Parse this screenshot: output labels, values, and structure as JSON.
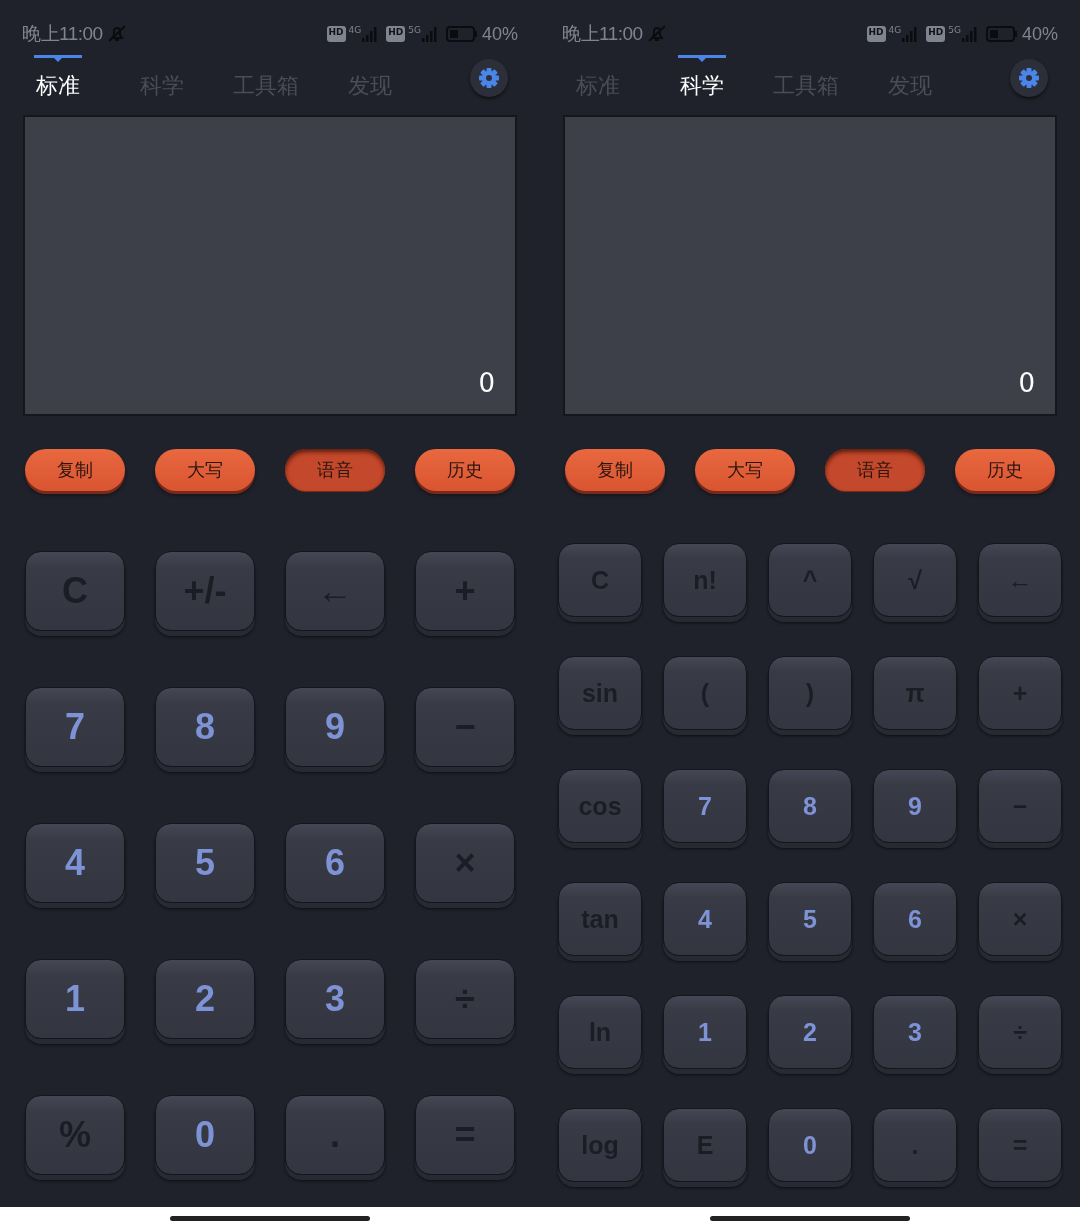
{
  "screens": [
    {
      "status_bar": {
        "time": "晚上11:00",
        "sims": [
          {
            "hd": "HD",
            "network": "4G"
          },
          {
            "hd": "HD",
            "network": "5G"
          }
        ],
        "battery": "40%"
      },
      "tabs": [
        {
          "label": "标准",
          "selected": true
        },
        {
          "label": "科学",
          "selected": false
        },
        {
          "label": "工具箱",
          "selected": false
        },
        {
          "label": "发现",
          "selected": false
        }
      ],
      "display": {
        "value": "0"
      },
      "tool_buttons": [
        {
          "label": "复制",
          "pressed": false
        },
        {
          "label": "大写",
          "pressed": false
        },
        {
          "label": "语音",
          "pressed": true
        },
        {
          "label": "历史",
          "pressed": false
        }
      ],
      "keys": [
        [
          {
            "label": "C",
            "kind": "func"
          },
          {
            "label": "+/-",
            "kind": "func"
          },
          {
            "label": "←",
            "kind": "func"
          },
          {
            "label": "+",
            "kind": "func"
          }
        ],
        [
          {
            "label": "7",
            "kind": "digit"
          },
          {
            "label": "8",
            "kind": "digit"
          },
          {
            "label": "9",
            "kind": "digit"
          },
          {
            "label": "−",
            "kind": "func"
          }
        ],
        [
          {
            "label": "4",
            "kind": "digit"
          },
          {
            "label": "5",
            "kind": "digit"
          },
          {
            "label": "6",
            "kind": "digit"
          },
          {
            "label": "×",
            "kind": "func"
          }
        ],
        [
          {
            "label": "1",
            "kind": "digit"
          },
          {
            "label": "2",
            "kind": "digit"
          },
          {
            "label": "3",
            "kind": "digit"
          },
          {
            "label": "÷",
            "kind": "func"
          }
        ],
        [
          {
            "label": "%",
            "kind": "func"
          },
          {
            "label": "0",
            "kind": "digit"
          },
          {
            "label": ".",
            "kind": "func"
          },
          {
            "label": "=",
            "kind": "func"
          }
        ]
      ]
    },
    {
      "status_bar": {
        "time": "晚上11:00",
        "sims": [
          {
            "hd": "HD",
            "network": "4G"
          },
          {
            "hd": "HD",
            "network": "5G"
          }
        ],
        "battery": "40%"
      },
      "tabs": [
        {
          "label": "标准",
          "selected": false
        },
        {
          "label": "科学",
          "selected": true
        },
        {
          "label": "工具箱",
          "selected": false
        },
        {
          "label": "发现",
          "selected": false
        }
      ],
      "display": {
        "value": "0"
      },
      "tool_buttons": [
        {
          "label": "复制",
          "pressed": false
        },
        {
          "label": "大写",
          "pressed": false
        },
        {
          "label": "语音",
          "pressed": true
        },
        {
          "label": "历史",
          "pressed": false
        }
      ],
      "keys": [
        [
          {
            "label": "C",
            "kind": "func"
          },
          {
            "label": "n!",
            "kind": "func"
          },
          {
            "label": "^",
            "kind": "func"
          },
          {
            "label": "√",
            "kind": "func"
          },
          {
            "label": "←",
            "kind": "func"
          }
        ],
        [
          {
            "label": "sin",
            "kind": "func"
          },
          {
            "label": "(",
            "kind": "func"
          },
          {
            "label": ")",
            "kind": "func"
          },
          {
            "label": "π",
            "kind": "func"
          },
          {
            "label": "+",
            "kind": "func"
          }
        ],
        [
          {
            "label": "cos",
            "kind": "func"
          },
          {
            "label": "7",
            "kind": "digit"
          },
          {
            "label": "8",
            "kind": "digit"
          },
          {
            "label": "9",
            "kind": "digit"
          },
          {
            "label": "−",
            "kind": "func"
          }
        ],
        [
          {
            "label": "tan",
            "kind": "func"
          },
          {
            "label": "4",
            "kind": "digit"
          },
          {
            "label": "5",
            "kind": "digit"
          },
          {
            "label": "6",
            "kind": "digit"
          },
          {
            "label": "×",
            "kind": "func"
          }
        ],
        [
          {
            "label": "ln",
            "kind": "func"
          },
          {
            "label": "1",
            "kind": "digit"
          },
          {
            "label": "2",
            "kind": "digit"
          },
          {
            "label": "3",
            "kind": "digit"
          },
          {
            "label": "÷",
            "kind": "func"
          }
        ],
        [
          {
            "label": "log",
            "kind": "func"
          },
          {
            "label": "E",
            "kind": "func"
          },
          {
            "label": "0",
            "kind": "digit"
          },
          {
            "label": ".",
            "kind": "func"
          },
          {
            "label": "=",
            "kind": "func"
          }
        ]
      ]
    }
  ]
}
